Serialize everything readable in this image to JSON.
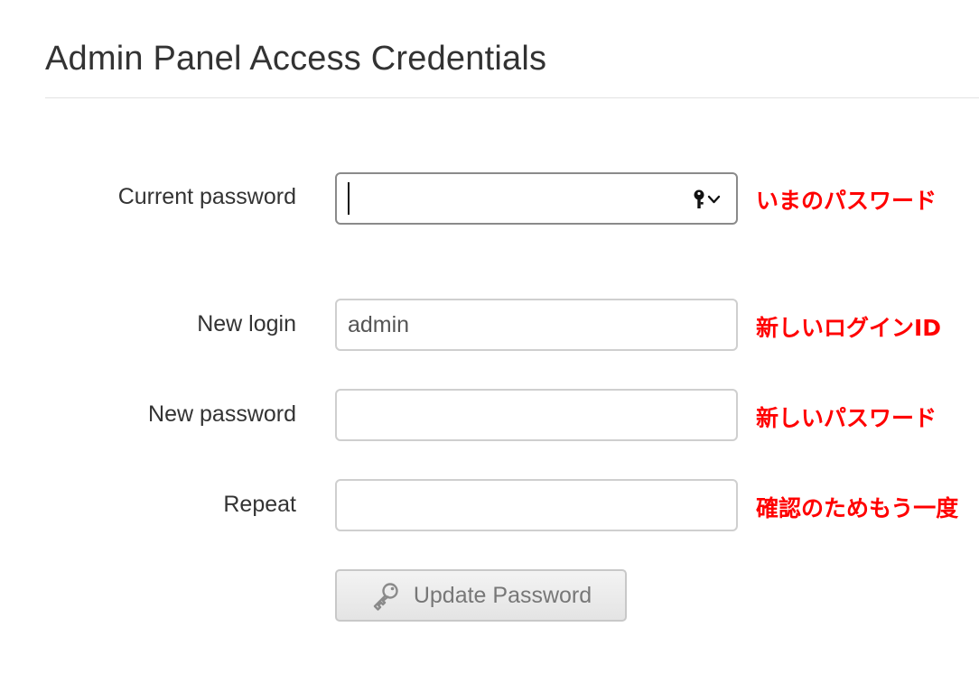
{
  "page": {
    "title": "Admin Panel Access Credentials"
  },
  "form": {
    "current_password": {
      "label": "Current password",
      "value": "",
      "note": "いまのパスワード",
      "icon": "key-dropdown-icon"
    },
    "new_login": {
      "label": "New login",
      "value": "admin",
      "note": "新しいログインID"
    },
    "new_password": {
      "label": "New password",
      "value": "",
      "note": "新しいパスワード"
    },
    "repeat": {
      "label": "Repeat",
      "value": "",
      "note": "確認のためもう一度"
    },
    "submit": {
      "label": "Update Password",
      "icon": "key-icon"
    }
  },
  "colors": {
    "note": "#ff0000",
    "text": "#333333",
    "border": "#cfcfcf"
  }
}
